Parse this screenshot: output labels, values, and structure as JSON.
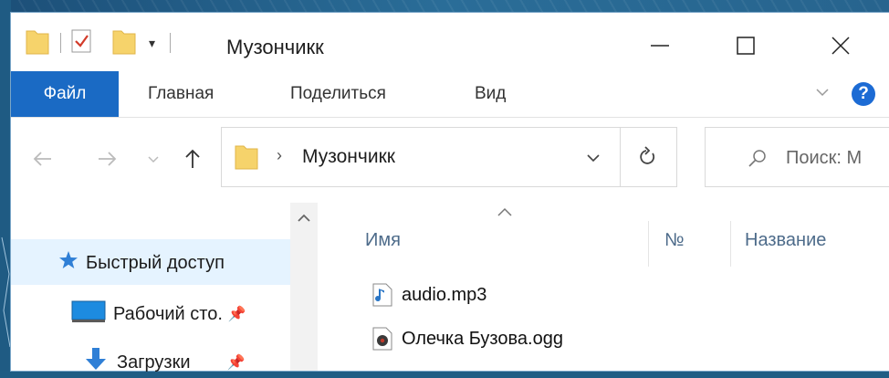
{
  "window": {
    "title": "Музончикк"
  },
  "ribbon": {
    "tabs": [
      {
        "label": "Файл",
        "active": true
      },
      {
        "label": "Главная"
      },
      {
        "label": "Поделиться"
      },
      {
        "label": "Вид"
      }
    ],
    "help_label": "?"
  },
  "address": {
    "path": "Музончикк",
    "separator": "›",
    "search_placeholder": "Поиск: М"
  },
  "navpane": {
    "items": [
      {
        "label": "Быстрый доступ",
        "icon": "star-icon"
      },
      {
        "label": "Рабочий сто.",
        "icon": "desktop-icon",
        "pinned": true
      },
      {
        "label": "Загрузки",
        "icon": "download-icon",
        "pinned": true
      }
    ]
  },
  "filelist": {
    "columns": [
      "Имя",
      "№",
      "Название"
    ],
    "files": [
      {
        "name": "audio.mp3",
        "icon": "audio-file-icon"
      },
      {
        "name": "Олечка Бузова.ogg",
        "icon": "media-file-icon"
      }
    ]
  },
  "colors": {
    "accent": "#1a6ac4",
    "selection": "#e5f3ff",
    "folder": "#f6d36b"
  }
}
